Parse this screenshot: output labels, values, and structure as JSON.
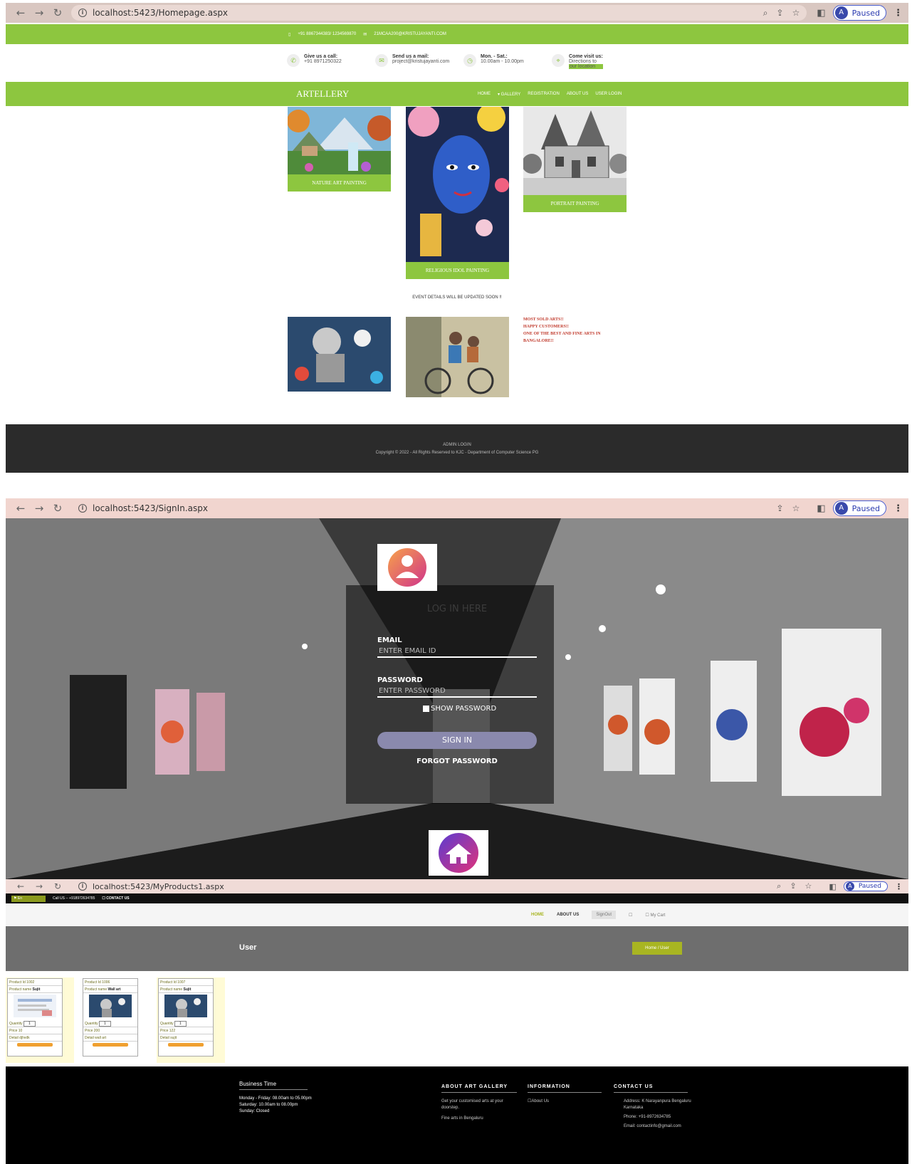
{
  "shot1": {
    "url": "localhost:5423/Homepage.aspx",
    "paused": "Paused",
    "avatar": "A",
    "topbar": {
      "phone": "+91 8867344383/ 1234569870",
      "email": "21MCAA200@KRISTUJAYANTI.COM"
    },
    "info": [
      {
        "title": "Give us a call:",
        "value": "+91 8971250322"
      },
      {
        "title": "Send us a mail:",
        "value": "project@kristujayanti.com"
      },
      {
        "title": "Mon. - Sat.:",
        "value": "10.00am - 10.00pm"
      },
      {
        "title": "Come visit us:",
        "value": "Directions to",
        "link": "our location"
      }
    ],
    "brand": "ARTELLERY",
    "menu": [
      "HOME",
      "▾ GALLERY",
      "REGISTRATION",
      "ABOUT US",
      "USER LOGIN"
    ],
    "cards": [
      "NATURE ART PAINTING",
      "RELIGIOUS IDOL PAINTING",
      "PORTRAIT PAINTING"
    ],
    "event": "EVENT DETAILS WILL BE UPDATED SOON !!",
    "sold": [
      "MOST SOLD ARTS!!",
      "HAPPY CUSTOMERS!!",
      "ONE OF THE BEST AND FINE ARTS IN",
      "BANGALORE!!"
    ],
    "footer": {
      "admin": "ADMIN LOGIN",
      "copyright": "Copyright © 2022 - All Rights Reserved to KJC - Department of Computer Science PG"
    }
  },
  "shot2": {
    "url": "localhost:5423/SignIn.aspx",
    "paused": "Paused",
    "avatar": "A",
    "title": "LOG IN HERE",
    "email_label": "EMAIL",
    "email_placeholder": "ENTER EMAIL ID",
    "password_label": "PASSWORD",
    "password_placeholder": "ENTER PASSWORD",
    "show_password": "SHOW PASSWORD",
    "signin": "SIGN IN",
    "forgot": "FORGOT PASSWORD"
  },
  "shot3": {
    "url": "localhost:5423/MyProducts1.aspx",
    "paused": "Paused",
    "avatar": "A",
    "lang": "⚑ En",
    "call": "Call US -- +918972634785",
    "contact": "☐ CONTACT US",
    "nav": [
      "HOME",
      "ABOUT US",
      "SignOut",
      "☐",
      "☐ My Cart"
    ],
    "banner": "User",
    "crumb": "Home  /  User",
    "products": [
      {
        "id": "Product Id 1002",
        "name": "Sujit",
        "qty": "1",
        "price": "Price 10",
        "detail": "Detail djhvdk"
      },
      {
        "id": "Product Id 1006",
        "name": "Wall art",
        "qty": "1",
        "price": "Price 200",
        "detail": "Detail wall art"
      },
      {
        "id": "Product Id 1007",
        "name": "Sujit",
        "qty": "1",
        "price": "Price 122",
        "detail": "Detail sujit"
      }
    ],
    "labels": {
      "name": "Product name",
      "qty": "Quantity"
    },
    "footer": {
      "time_title": "Business Time",
      "time": [
        "Monday - Friday: 08.00am to 05.00pm",
        "Saturday: 10.00am to 08.00pm",
        "Sunday: Closed"
      ],
      "about_title": "ABOUT ART GALLERY",
      "about": [
        "Get your customised arts at your doorstep.",
        "Fine arts in Bengaluru"
      ],
      "info_title": "INFORMATION",
      "info": "☐About Us",
      "contact_title": "CONTACT US",
      "address": "Address: K Narayanpura Bengaluru Karnataka",
      "phone": "Phone: +91-8972634785",
      "email": "Email: contactinfo@gmail.com"
    }
  }
}
